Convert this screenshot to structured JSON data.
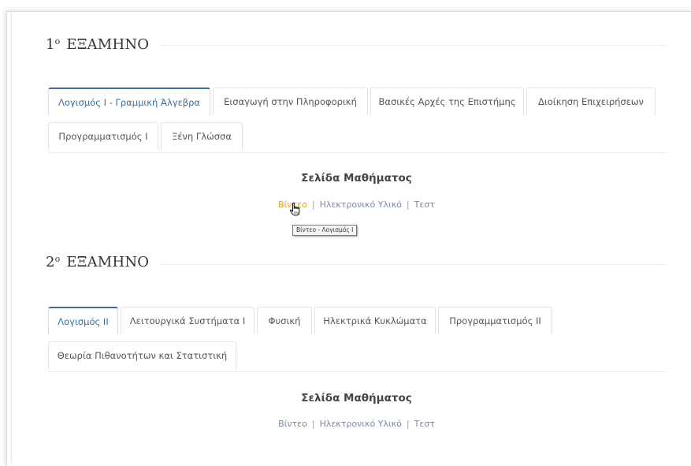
{
  "semesters": [
    {
      "title_num": "1",
      "title_sup": "ο",
      "title_text": "ΕΞΑΜΗΝΟ",
      "tabs": [
        "Λογισμός Ι - Γραμμική Άλγεβρα",
        "Εισαγωγή στην Πληροφορική",
        "Βασικές Αρχές της Επιστήμης",
        "Διοίκηση Επιχειρήσεων",
        "Προγραμματισμός Ι",
        "Ξένη Γλώσσα"
      ],
      "active_tab": "Λογισμός Ι - Γραμμική Άλγεβρα",
      "panel_heading": "Σελίδα Μαθήματος",
      "links": [
        "Βίντεο",
        "Ηλεκτρονικό Υλικό",
        "Τεστ"
      ],
      "separator": "|",
      "hover_link": "Βίντεο",
      "tooltip": "Βίντεο - Λογισμός Ι"
    },
    {
      "title_num": "2",
      "title_sup": "ο",
      "title_text": "ΕΞΑΜΗΝΟ",
      "tabs": [
        "Λογισμός ΙΙ",
        "Λειτουργικά Συστήματα Ι",
        "Φυσική",
        "Ηλεκτρικά Κυκλώματα",
        "Προγραμματισμός ΙΙ",
        "Θεωρία Πιθανοτήτων και Στατιστική"
      ],
      "active_tab": "Λογισμός ΙΙ",
      "panel_heading": "Σελίδα Μαθήματος",
      "links": [
        "Βίντεο",
        "Ηλεκτρονικό Υλικό",
        "Τεστ"
      ],
      "separator": "|"
    }
  ],
  "colors": {
    "active_tab_text": "#3d6f9e",
    "active_tab_border": "#3f6d97",
    "link_hover": "#e39a2c",
    "link": "#7a8aa0"
  },
  "icons": {
    "cursor": "hand-pointer-icon"
  }
}
